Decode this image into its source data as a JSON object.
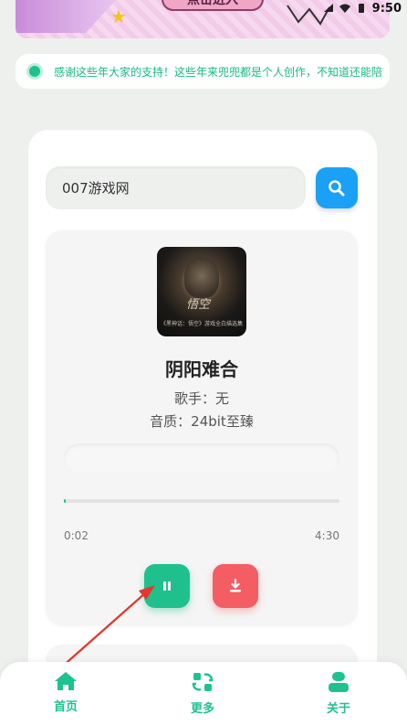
{
  "banner": {
    "cta_label": "点击进入"
  },
  "status_bar": {
    "time": "9:50"
  },
  "notice": {
    "text": "感谢这些年大家的支持！这些年来兜兜都是个人创作，不知道还能陪"
  },
  "search": {
    "value": "007游戏网"
  },
  "player": {
    "cover_calligraphy": "悟空",
    "cover_caption": "《黑神话：悟空》游戏全白描选集",
    "song_title": "阴阳难合",
    "artist_line": "歌手：无",
    "quality_line": "音质：24bit至臻",
    "current_time": "0:02",
    "total_time": "4:30",
    "progress_fraction": 0.008
  },
  "nav": {
    "items": [
      {
        "label": "首页",
        "icon": "home-icon"
      },
      {
        "label": "更多",
        "icon": "more-icon"
      },
      {
        "label": "关于",
        "icon": "user-icon"
      }
    ]
  },
  "colors": {
    "accent": "#1ec28f",
    "search_button": "#1aa1f5",
    "download_button": "#f35d63"
  }
}
